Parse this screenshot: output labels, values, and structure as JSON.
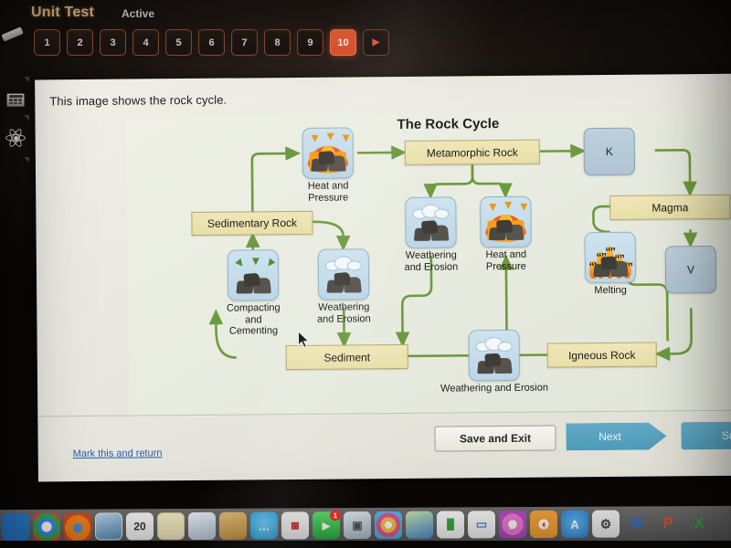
{
  "quiz_header": {
    "title": "Unit Test",
    "status": "Active",
    "question_numbers": [
      "1",
      "2",
      "3",
      "4",
      "5",
      "6",
      "7",
      "8",
      "9",
      "10"
    ],
    "current_question": "10",
    "next_arrow_glyph": "▶",
    "accent_color": "#e8603a",
    "title_color": "#e8c08a"
  },
  "left_rail": {
    "items": [
      {
        "name": "calculator-tool",
        "label": "Calculator"
      },
      {
        "name": "periodic-table-tool",
        "label": "Science Reference"
      }
    ]
  },
  "question": {
    "prompt": "This image shows the rock cycle."
  },
  "diagram": {
    "title": "The Rock Cycle",
    "rock_box_color": "#e8dfa9",
    "blank_box_color": "#b0c4d3",
    "arrow_color": "#6d9a3f",
    "rock_boxes": [
      {
        "id": "sedimentary",
        "label": "Sedimentary Rock"
      },
      {
        "id": "metamorphic",
        "label": "Metamorphic Rock"
      },
      {
        "id": "magma",
        "label": "Magma"
      },
      {
        "id": "sediment",
        "label": "Sediment"
      },
      {
        "id": "igneous",
        "label": "Igneous Rock"
      }
    ],
    "blank_boxes": [
      {
        "id": "blank-k",
        "label": "K"
      },
      {
        "id": "blank-v",
        "label": "V"
      }
    ],
    "processes": [
      {
        "id": "heat-pressure-top",
        "label": "Heat and\nPressure",
        "icon": "rock-with-flames-icon"
      },
      {
        "id": "compacting-cementing",
        "label": "Compacting\nand Cementing",
        "icon": "rock-with-down-arrows-icon"
      },
      {
        "id": "weathering-left",
        "label": "Weathering\nand Erosion",
        "icon": "rock-with-rain-cloud-icon"
      },
      {
        "id": "weathering-middle",
        "label": "Weathering\nand Erosion",
        "icon": "rock-with-rain-cloud-icon"
      },
      {
        "id": "heat-pressure-middle",
        "label": "Heat and\nPressure",
        "icon": "rock-with-flames-icon"
      },
      {
        "id": "melting",
        "label": "Melting",
        "icon": "rock-in-fire-icon"
      },
      {
        "id": "weathering-bottom",
        "label": "Weathering and Erosion",
        "icon": "rock-with-rain-cloud-icon"
      }
    ]
  },
  "footer": {
    "mark_and_return": "Mark this and return",
    "save_and_exit": "Save and Exit",
    "next": "Next",
    "submit": "Sub"
  },
  "dock": {
    "items": [
      {
        "name": "finder-icon",
        "glyph": "◑",
        "bg": "#2a7fd4"
      },
      {
        "name": "chrome-icon",
        "glyph": "◉",
        "bg": "#d9d9d9"
      },
      {
        "name": "firefox-icon",
        "glyph": "◉",
        "bg": "#e8751a"
      },
      {
        "name": "photos-icon",
        "glyph": "❖",
        "bg": "#7fb4d8"
      },
      {
        "name": "calendar-icon",
        "glyph": "20",
        "bg": "#f4f4f4"
      },
      {
        "name": "notes-icon",
        "glyph": "☰",
        "bg": "#f5ecc2"
      },
      {
        "name": "mail-icon",
        "glyph": "✉",
        "bg": "#e4e9ee"
      },
      {
        "name": "contacts-icon",
        "glyph": "☎",
        "bg": "#d4a24a"
      },
      {
        "name": "messages-icon",
        "glyph": "…",
        "bg": "#3cb7f0"
      },
      {
        "name": "news-icon",
        "glyph": "▦",
        "bg": "#f2f2f2"
      },
      {
        "name": "facetime-icon",
        "glyph": "▶",
        "bg": "#49c453",
        "badge": "1"
      },
      {
        "name": "preview-icon",
        "glyph": "▣",
        "bg": "#cfd6dd"
      },
      {
        "name": "photos-app-icon",
        "glyph": "✸",
        "bg": "#f6f6f6"
      },
      {
        "name": "keynote-people-icon",
        "glyph": "☺",
        "bg": "#e8f0f6"
      },
      {
        "name": "numbers-icon",
        "glyph": "█",
        "bg": "#f4f4f4"
      },
      {
        "name": "keynote-icon",
        "glyph": "▭",
        "bg": "#f4f4f4"
      },
      {
        "name": "itunes-icon",
        "glyph": "♫",
        "bg": "#f0a8d8"
      },
      {
        "name": "ibooks-icon",
        "glyph": "◖",
        "bg": "#f08c2e"
      },
      {
        "name": "app-store-icon",
        "glyph": "A",
        "bg": "#3aa0e8"
      },
      {
        "name": "system-prefs-icon",
        "glyph": "⚙",
        "bg": "#e8e8e8"
      },
      {
        "name": "word-icon",
        "glyph": "W",
        "bg": "transparent"
      },
      {
        "name": "powerpoint-icon",
        "glyph": "P",
        "bg": "transparent"
      },
      {
        "name": "excel-icon",
        "glyph": "X",
        "bg": "transparent"
      }
    ]
  }
}
